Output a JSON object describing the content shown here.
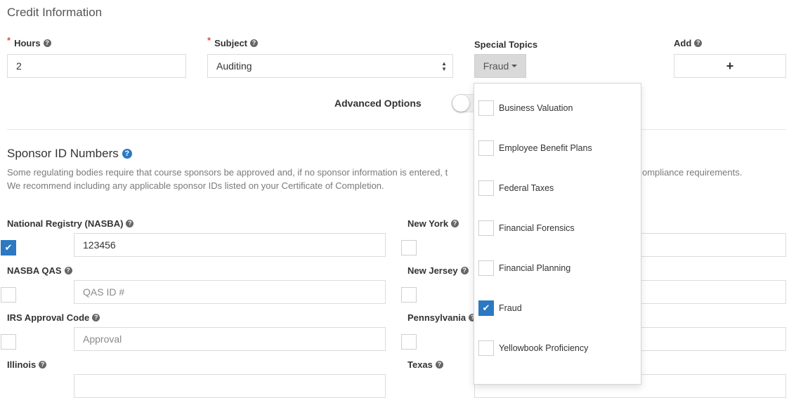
{
  "credit": {
    "title": "Credit Information",
    "hours_label": "Hours",
    "hours_value": "2",
    "subject_label": "Subject",
    "subject_value": "Auditing",
    "special_topics_label": "Special Topics",
    "special_topics_button": "Fraud",
    "add_label": "Add",
    "add_button": "+",
    "advanced_options_label": "Advanced Options",
    "required_marker": "*"
  },
  "dropdown": {
    "items": [
      {
        "label": "Business Valuation",
        "checked": false
      },
      {
        "label": "Employee Benefit Plans",
        "checked": false
      },
      {
        "label": "Federal Taxes",
        "checked": false
      },
      {
        "label": "Financial Forensics",
        "checked": false
      },
      {
        "label": "Financial Planning",
        "checked": false
      },
      {
        "label": "Fraud",
        "checked": true
      },
      {
        "label": "Yellowbook Proficiency",
        "checked": false
      }
    ]
  },
  "sponsor": {
    "title": "Sponsor ID Numbers",
    "desc_line1_left": "Some regulating bodies require that course sponsors be approved and, if no sponsor information is entered, t",
    "desc_line1_right": "ompliance requirements.",
    "desc_line2": "We recommend including any applicable sponsor IDs listed on your Certificate of Completion.",
    "left": [
      {
        "label": "National Registry (NASBA)",
        "checked": true,
        "value": "123456",
        "placeholder": ""
      },
      {
        "label": "NASBA QAS",
        "checked": false,
        "value": "",
        "placeholder": "QAS ID #"
      },
      {
        "label": "IRS Approval Code",
        "checked": false,
        "value": "",
        "placeholder": "Approval"
      },
      {
        "label": "Illinois",
        "checked": false,
        "value": "",
        "placeholder": ""
      }
    ],
    "right": [
      {
        "label": "New York",
        "checked": false
      },
      {
        "label": "New Jersey",
        "checked": false
      },
      {
        "label": "Pennsylvania",
        "checked": false
      },
      {
        "label": "Texas",
        "checked": false
      }
    ]
  },
  "icons": {
    "help": "?",
    "check": "✔",
    "select_up": "▲",
    "select_down": "▼"
  }
}
